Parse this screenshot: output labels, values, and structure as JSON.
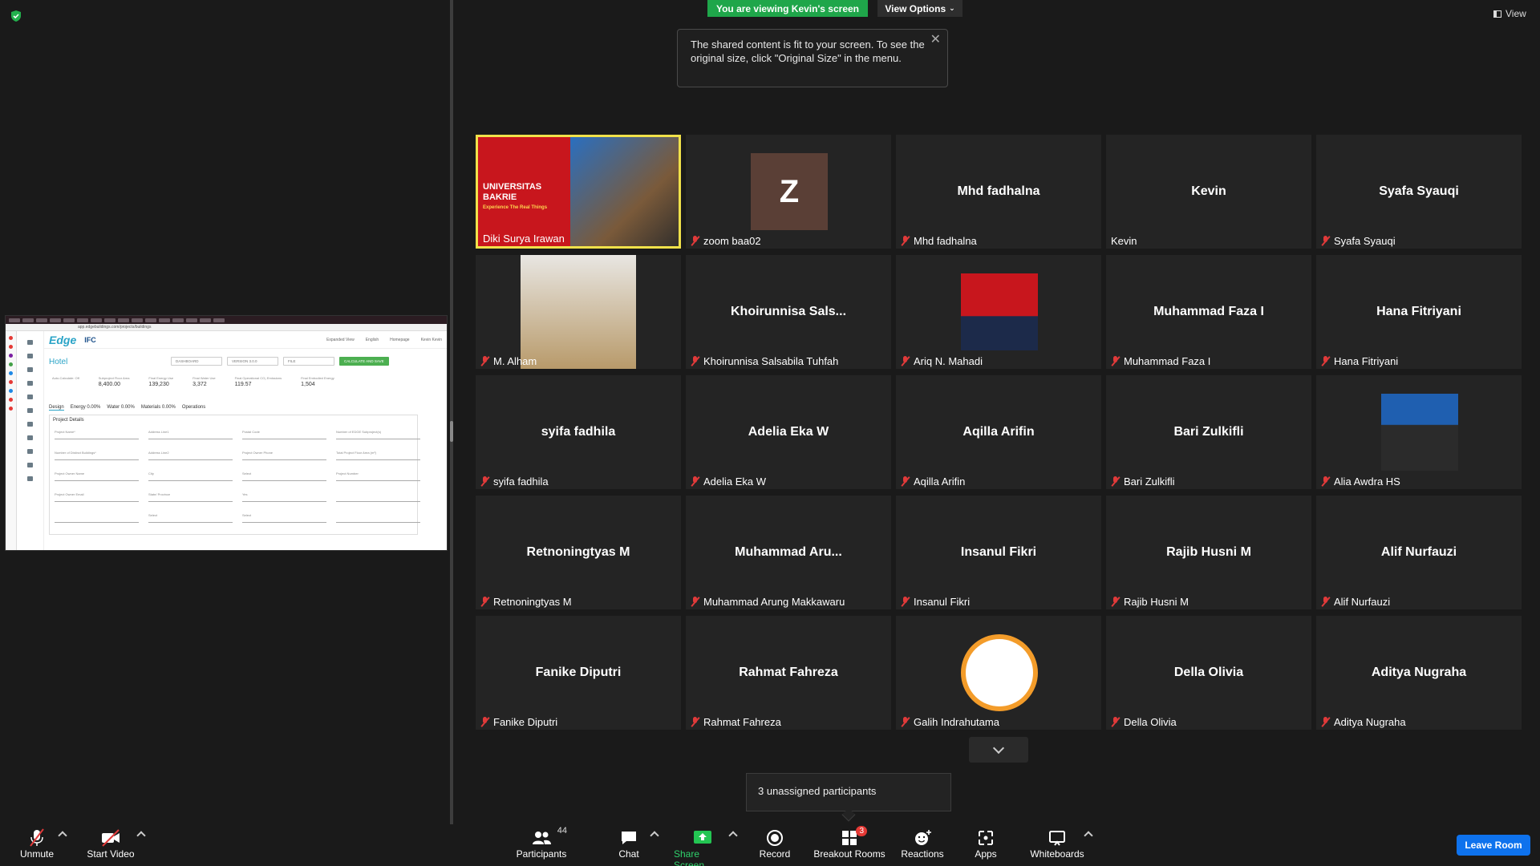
{
  "banner": {
    "viewing": "You are viewing Kevin's screen",
    "view_options": "View Options"
  },
  "tooltip": {
    "text": "The shared content is fit to your screen. To see the original size, click \"Original Size\" in the menu."
  },
  "view_label": "View",
  "shared": {
    "url": "app.edgebuildings.com/projects/buildings",
    "logo": "Edge",
    "logo2": "IFC",
    "header_items": [
      "Expanded View",
      "English",
      "Homepage",
      "Kevin Kevin"
    ],
    "project_title": "Hotel",
    "buttons": {
      "dashboard": "DASHBOARD",
      "version": "VERSION 3.0.0",
      "file": "FILE",
      "calc": "CALCULATE AND SAVE"
    },
    "metrics": [
      {
        "label": "Auto-Calculate: Off",
        "value": ""
      },
      {
        "label": "Subproject Floor Area",
        "value": "8,400.00"
      },
      {
        "label": "Final Energy Use",
        "value": "139,230"
      },
      {
        "label": "Final Water Use",
        "value": "3,372"
      },
      {
        "label": "Final Operational CO₂ Emissions",
        "value": "119.57"
      },
      {
        "label": "Final Embodied Energy",
        "value": "1,504"
      }
    ],
    "tabs": [
      "Design",
      "Energy 0.00%",
      "Water 0.00%",
      "Materials 0.00%",
      "Operations"
    ],
    "details_title": "Project Details",
    "fields": [
      "Project Name*",
      "Address Line1",
      "Postal Code",
      "Number of EDGE Subproject(s)",
      "Number of Distinct Buildings*",
      "Address Line2",
      "Project Owner Phone",
      "Total Project Floor Area (m²)",
      "Project Owner Name",
      "City",
      "Select",
      "Project Number",
      "Project Owner Email",
      "State/ Province",
      "Yes",
      "",
      "",
      "Select",
      "Select",
      ""
    ]
  },
  "participants": [
    {
      "name": "Diki Surya Irawan",
      "type": "video",
      "muted": false,
      "active": true
    },
    {
      "name": "zoom baa02",
      "type": "initial",
      "initial": "Z",
      "muted": true
    },
    {
      "name": "Mhd fadhalna",
      "center": "Mhd fadhalna",
      "muted": true
    },
    {
      "name": "Kevin",
      "center": "Kevin",
      "muted": false
    },
    {
      "name": "Syafa Syauqi",
      "center": "Syafa Syauqi",
      "muted": true
    },
    {
      "name": "M. Alham",
      "type": "photo",
      "muted": true
    },
    {
      "name": "Khoirunnisa Salsabila Tuhfah",
      "center": "Khoirunnisa  Sals...",
      "muted": true
    },
    {
      "name": "Ariq N. Mahadi",
      "type": "photo",
      "muted": true
    },
    {
      "name": "Muhammad Faza I",
      "center": "Muhammad Faza I",
      "muted": true
    },
    {
      "name": "Hana Fitriyani",
      "center": "Hana Fitriyani",
      "muted": true
    },
    {
      "name": "syifa fadhila",
      "center": "syifa fadhila",
      "muted": true
    },
    {
      "name": "Adelia Eka W",
      "center": "Adelia Eka W",
      "muted": true
    },
    {
      "name": "Aqilla Arifin",
      "center": "Aqilla Arifin",
      "muted": true
    },
    {
      "name": "Bari Zulkifli",
      "center": "Bari Zulkifli",
      "muted": true
    },
    {
      "name": "Alia Awdra HS",
      "type": "photo",
      "muted": true
    },
    {
      "name": "Retnoningtyas M",
      "center": "Retnoningtyas M",
      "muted": true
    },
    {
      "name": "Muhammad Arung Makkawaru",
      "center": "Muhammad  Aru...",
      "muted": true
    },
    {
      "name": "Insanul Fikri",
      "center": "Insanul Fikri",
      "muted": true
    },
    {
      "name": "Rajib Husni M",
      "center": "Rajib Husni M",
      "muted": true
    },
    {
      "name": "Alif Nurfauzi",
      "center": "Alif Nurfauzi",
      "muted": true
    },
    {
      "name": "Fanike Diputri",
      "center": "Fanike Diputri",
      "muted": true
    },
    {
      "name": "Rahmat Fahreza",
      "center": "Rahmat Fahreza",
      "muted": true
    },
    {
      "name": "Galih Indrahutama",
      "type": "photo",
      "muted": true
    },
    {
      "name": "Della Olivia",
      "center": "Della Olivia",
      "muted": true
    },
    {
      "name": "Aditya Nugraha",
      "center": "Aditya Nugraha",
      "muted": true
    }
  ],
  "video_overlay": {
    "line1": "UNIVERSITAS",
    "line2": "BAKRIE",
    "line3": "Experience The Real Things"
  },
  "unassigned": "3 unassigned participants",
  "toolbar": {
    "unmute": "Unmute",
    "start_video": "Start Video",
    "participants": "Participants",
    "participants_count": "44",
    "chat": "Chat",
    "share": "Share Screen",
    "record": "Record",
    "breakout": "Breakout Rooms",
    "breakout_badge": "3",
    "reactions": "Reactions",
    "apps": "Apps",
    "whiteboards": "Whiteboards",
    "leave": "Leave Room"
  },
  "colors": {
    "accent_green": "#1fa64a",
    "leave_blue": "#0e72ed",
    "active_border": "#f0e14a",
    "muted_red": "#e03a3a"
  }
}
